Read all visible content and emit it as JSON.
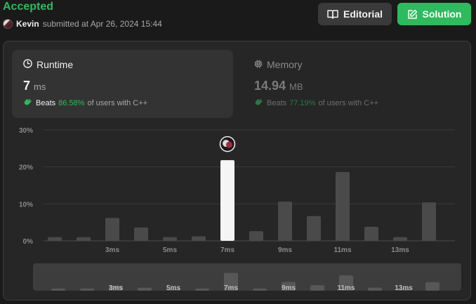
{
  "status": "Accepted",
  "submission": {
    "user": "Kevin",
    "text": "submitted at Apr 26, 2024 15:44"
  },
  "buttons": {
    "editorial": "Editorial",
    "solution": "Solution"
  },
  "runtime": {
    "label": "Runtime",
    "value": "7",
    "unit": "ms",
    "beats_label": "Beats",
    "percent": "86.58%",
    "suffix": "of users with C++"
  },
  "memory": {
    "label": "Memory",
    "value": "14.94",
    "unit": "MB",
    "beats_label": "Beats",
    "percent": "77.19%",
    "suffix": "of users with C++"
  },
  "colors": {
    "accent": "#2cbb5d",
    "bar": "#4a4a4a",
    "highlight_bar": "#f5f5f5"
  },
  "chart_data": {
    "type": "bar",
    "yticks": [
      "30%",
      "20%",
      "10%",
      "0%"
    ],
    "ylim": [
      0,
      30
    ],
    "values": [
      1.0,
      1.0,
      6.2,
      3.6,
      1.0,
      1.2,
      21.8,
      2.6,
      10.6,
      6.7,
      18.6,
      3.8,
      1.0,
      10.4
    ],
    "highlight_index": 6,
    "xlabels": [
      {
        "index": 2,
        "text": "3ms"
      },
      {
        "index": 4,
        "text": "5ms"
      },
      {
        "index": 6,
        "text": "7ms"
      },
      {
        "index": 8,
        "text": "9ms"
      },
      {
        "index": 10,
        "text": "11ms"
      },
      {
        "index": 12,
        "text": "13ms"
      }
    ]
  }
}
